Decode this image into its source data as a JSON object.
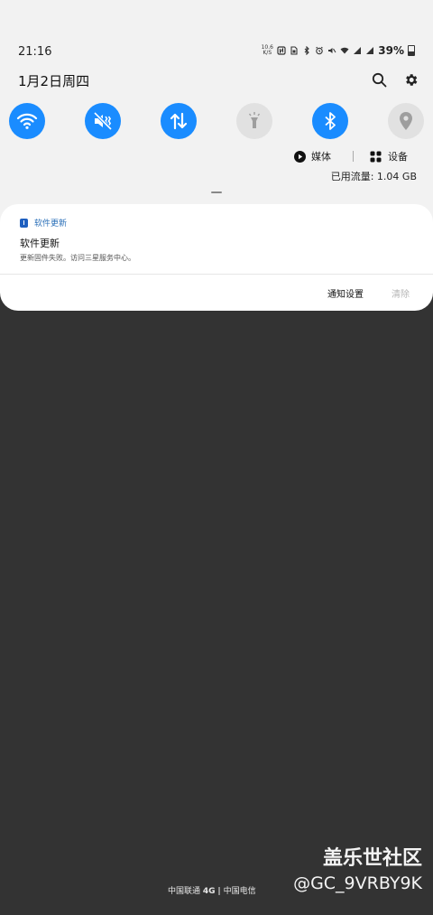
{
  "status_bar": {
    "time": "21:16",
    "net_speed_value": "10.6",
    "net_speed_unit": "K/S",
    "battery": "39%"
  },
  "header": {
    "date": "1月2日周四",
    "search_icon": "search-icon",
    "settings_icon": "gear-icon"
  },
  "quick_settings": [
    {
      "name": "wifi",
      "icon": "wifi-icon",
      "on": true
    },
    {
      "name": "mute",
      "icon": "mute-icon",
      "on": true
    },
    {
      "name": "mobile-data",
      "icon": "data-transfer-icon",
      "on": true
    },
    {
      "name": "flashlight",
      "icon": "flashlight-icon",
      "on": false
    },
    {
      "name": "bluetooth",
      "icon": "bluetooth-icon",
      "on": true
    },
    {
      "name": "location",
      "icon": "location-icon",
      "on": false
    }
  ],
  "media": {
    "media_label": "媒体",
    "devices_label": "设备"
  },
  "data_usage": "已用流量: 1.04 GB",
  "notification": {
    "app_name": "软件更新",
    "title": "软件更新",
    "body": "更新固件失败。访问三星服务中心。",
    "settings_action": "通知设置",
    "clear_action": "清除"
  },
  "carrier": {
    "primary": "中国联通",
    "network": "4G",
    "separator": "|",
    "secondary": "中国电信"
  },
  "watermark": {
    "line1": "盖乐世社区",
    "line2": "@GC_9VRBY9K"
  },
  "colors": {
    "accent": "#1a8cff",
    "panel": "#f2f2f2",
    "background": "#333333"
  }
}
